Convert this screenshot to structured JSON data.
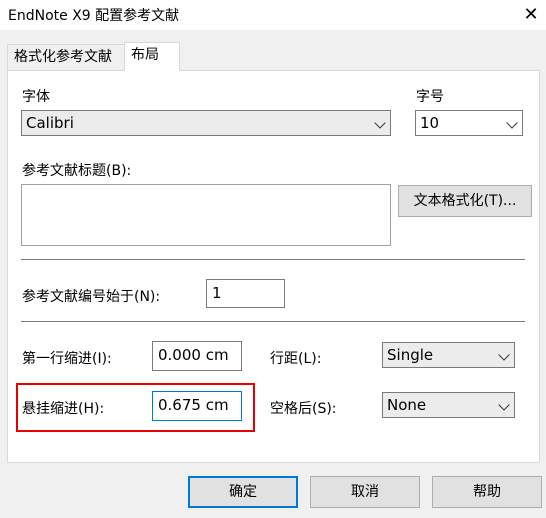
{
  "window": {
    "title": "EndNote X9 配置参考文献",
    "close_glyph": "✕"
  },
  "tabs": [
    {
      "label": "格式化参考文献",
      "active": false
    },
    {
      "label": "布局",
      "active": true
    }
  ],
  "font": {
    "label": "字体",
    "value": "Calibri"
  },
  "font_size": {
    "label": "字号",
    "value": "10"
  },
  "bibliography_title": {
    "label": "参考文献标题(B):",
    "value": "",
    "format_button": "文本格式化(T)..."
  },
  "start_number": {
    "label": "参考文献编号始于(N):",
    "value": "1"
  },
  "first_line_indent": {
    "label": "第一行缩进(I):",
    "value": "0.000 cm"
  },
  "line_spacing": {
    "label": "行距(L):",
    "value": "Single"
  },
  "hanging_indent": {
    "label": "悬挂缩进(H):",
    "value": "0.675 cm"
  },
  "space_after": {
    "label": "空格后(S):",
    "value": "None"
  },
  "buttons": {
    "ok": "确定",
    "cancel": "取消",
    "help": "帮助"
  },
  "colors": {
    "highlight": "#e60000",
    "focus": "#0078d7"
  }
}
